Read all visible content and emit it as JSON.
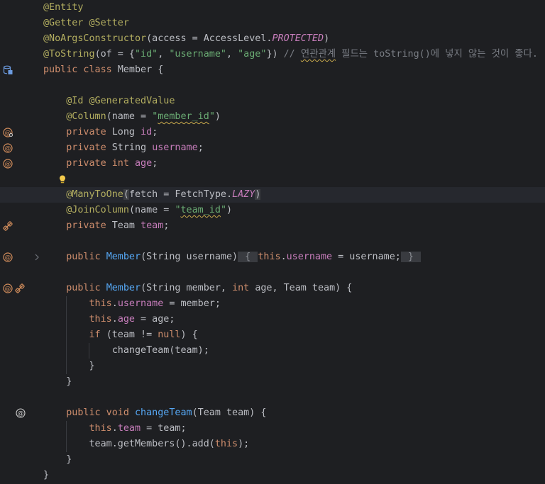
{
  "editor": {
    "lines": [
      {
        "tokens": [
          {
            "t": "@Entity",
            "c": "ann"
          }
        ]
      },
      {
        "tokens": [
          {
            "t": "@Getter @Setter",
            "c": "ann"
          }
        ]
      },
      {
        "tokens": [
          {
            "t": "@NoArgsConstructor",
            "c": "ann"
          },
          {
            "t": "(access = AccessLevel.",
            "c": ""
          },
          {
            "t": "PROTECTED",
            "c": "cst"
          },
          {
            "t": ")",
            "c": ""
          }
        ]
      },
      {
        "tokens": [
          {
            "t": "@ToString",
            "c": "ann"
          },
          {
            "t": "(of = {",
            "c": ""
          },
          {
            "t": "\"id\"",
            "c": "str"
          },
          {
            "t": ", ",
            "c": ""
          },
          {
            "t": "\"username\"",
            "c": "str"
          },
          {
            "t": ", ",
            "c": ""
          },
          {
            "t": "\"age\"",
            "c": "str"
          },
          {
            "t": "}) ",
            "c": ""
          },
          {
            "t": "// ",
            "c": "cmt"
          },
          {
            "t": "연관관계",
            "c": "cmt sq"
          },
          {
            "t": " 필드는 toString()에 넣지 않는 것이 좋다.",
            "c": "cmt"
          }
        ]
      },
      {
        "icons": [
          "database-icon"
        ],
        "tokens": [
          {
            "t": "public class ",
            "c": "kw"
          },
          {
            "t": "Member {",
            "c": ""
          }
        ]
      },
      {
        "tokens": []
      },
      {
        "tokens": [
          {
            "t": "    "
          },
          {
            "t": "@Id @GeneratedValue",
            "c": "ann"
          }
        ]
      },
      {
        "tokens": [
          {
            "t": "    "
          },
          {
            "t": "@Column",
            "c": "ann"
          },
          {
            "t": "(name = ",
            "c": ""
          },
          {
            "t": "\"",
            "c": "str"
          },
          {
            "t": "member_id",
            "c": "str sq"
          },
          {
            "t": "\"",
            "c": "str"
          },
          {
            "t": ")",
            "c": ""
          }
        ]
      },
      {
        "icons": [
          "id-column-icon"
        ],
        "tokens": [
          {
            "t": "    "
          },
          {
            "t": "private ",
            "c": "kw"
          },
          {
            "t": "Long ",
            "c": ""
          },
          {
            "t": "id",
            "c": "fld"
          },
          {
            "t": ";",
            "c": ""
          }
        ]
      },
      {
        "icons": [
          "column-icon"
        ],
        "tokens": [
          {
            "t": "    "
          },
          {
            "t": "private ",
            "c": "kw"
          },
          {
            "t": "String ",
            "c": ""
          },
          {
            "t": "username",
            "c": "fld"
          },
          {
            "t": ";",
            "c": ""
          }
        ]
      },
      {
        "icons": [
          "column-icon"
        ],
        "tokens": [
          {
            "t": "    "
          },
          {
            "t": "private int ",
            "c": "kw"
          },
          {
            "t": "age",
            "c": "fld"
          },
          {
            "t": ";",
            "c": ""
          }
        ]
      },
      {
        "bulb": true,
        "tokens": []
      },
      {
        "current": true,
        "tokens": [
          {
            "t": "    "
          },
          {
            "t": "@ManyToOne",
            "c": "ann"
          },
          {
            "t": "(",
            "c": "hl"
          },
          {
            "t": "fetch = FetchType.",
            "c": ""
          },
          {
            "t": "LAZY",
            "c": "cst"
          },
          {
            "t": ")",
            "c": "hl"
          }
        ]
      },
      {
        "tokens": [
          {
            "t": "    "
          },
          {
            "t": "@JoinColumn",
            "c": "ann"
          },
          {
            "t": "(name = ",
            "c": ""
          },
          {
            "t": "\"",
            "c": "str"
          },
          {
            "t": "team_id",
            "c": "str sq"
          },
          {
            "t": "\"",
            "c": "str"
          },
          {
            "t": ")",
            "c": ""
          }
        ]
      },
      {
        "icons": [
          "relation-icon"
        ],
        "tokens": [
          {
            "t": "    "
          },
          {
            "t": "private ",
            "c": "kw"
          },
          {
            "t": "Team ",
            "c": ""
          },
          {
            "t": "team",
            "c": "fld"
          },
          {
            "t": ";",
            "c": ""
          }
        ]
      },
      {
        "tokens": []
      },
      {
        "icons": [
          "column-icon"
        ],
        "fold": true,
        "tokens": [
          {
            "t": "    "
          },
          {
            "t": "public ",
            "c": "kw"
          },
          {
            "t": "Member",
            "c": "fn"
          },
          {
            "t": "(String username)",
            "c": ""
          },
          {
            "t": " { ",
            "c": "fold"
          },
          {
            "t": "this",
            "c": "kw"
          },
          {
            "t": ".",
            "c": ""
          },
          {
            "t": "username",
            "c": "fld"
          },
          {
            "t": " = username;",
            "c": ""
          },
          {
            "t": " } ",
            "c": "fold"
          }
        ]
      },
      {
        "tokens": []
      },
      {
        "icons": [
          "column-icon",
          "relation-icon"
        ],
        "tokens": [
          {
            "t": "    "
          },
          {
            "t": "public ",
            "c": "kw"
          },
          {
            "t": "Member",
            "c": "fn"
          },
          {
            "t": "(String member, ",
            "c": ""
          },
          {
            "t": "int ",
            "c": "kw"
          },
          {
            "t": "age, Team team) {",
            "c": ""
          }
        ]
      },
      {
        "tokens": [
          {
            "t": "        "
          },
          {
            "t": "this",
            "c": "kw"
          },
          {
            "t": ".",
            "c": ""
          },
          {
            "t": "username",
            "c": "fld"
          },
          {
            "t": " = member;",
            "c": ""
          }
        ]
      },
      {
        "tokens": [
          {
            "t": "        "
          },
          {
            "t": "this",
            "c": "kw"
          },
          {
            "t": ".",
            "c": ""
          },
          {
            "t": "age",
            "c": "fld"
          },
          {
            "t": " = age;",
            "c": ""
          }
        ]
      },
      {
        "tokens": [
          {
            "t": "        "
          },
          {
            "t": "if ",
            "c": "kw"
          },
          {
            "t": "(team != ",
            "c": ""
          },
          {
            "t": "null",
            "c": "kw"
          },
          {
            "t": ") {",
            "c": ""
          }
        ]
      },
      {
        "tokens": [
          {
            "t": "            "
          },
          {
            "t": "changeTeam(team);",
            "c": ""
          }
        ]
      },
      {
        "tokens": [
          {
            "t": "        "
          },
          {
            "t": "}",
            "c": ""
          }
        ]
      },
      {
        "tokens": [
          {
            "t": "    "
          },
          {
            "t": "}",
            "c": ""
          }
        ]
      },
      {
        "tokens": []
      },
      {
        "icons": [
          "at-sign-icon"
        ],
        "tokens": [
          {
            "t": "    "
          },
          {
            "t": "public void ",
            "c": "kw"
          },
          {
            "t": "changeTeam",
            "c": "fn"
          },
          {
            "t": "(Team team) {",
            "c": ""
          }
        ]
      },
      {
        "tokens": [
          {
            "t": "        "
          },
          {
            "t": "this",
            "c": "kw"
          },
          {
            "t": ".",
            "c": ""
          },
          {
            "t": "team",
            "c": "fld"
          },
          {
            "t": " = team;",
            "c": ""
          }
        ]
      },
      {
        "tokens": [
          {
            "t": "        "
          },
          {
            "t": "team.getMembers().add(",
            "c": ""
          },
          {
            "t": "this",
            "c": "kw"
          },
          {
            "t": ");",
            "c": ""
          }
        ]
      },
      {
        "tokens": [
          {
            "t": "    "
          },
          {
            "t": "}",
            "c": ""
          }
        ]
      },
      {
        "tokens": [
          {
            "t": "}",
            "c": ""
          }
        ]
      }
    ]
  },
  "colors": {
    "background": "#1e1f22",
    "text": "#bcbec4",
    "annotation": "#b3ae60",
    "keyword": "#cf8e6d",
    "string": "#6aab73",
    "field": "#c77dbb",
    "function": "#56a8f5",
    "comment": "#7a7e85",
    "icon": "#d28d5c"
  }
}
